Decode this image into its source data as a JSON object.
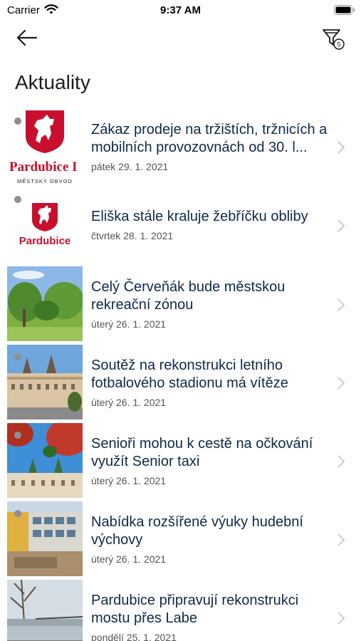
{
  "status_bar": {
    "carrier": "Carrier",
    "time": "9:37 AM"
  },
  "nav": {
    "back_icon": "arrow-left-icon",
    "filter_icon": "filter-icon",
    "filter_count": "5"
  },
  "page_title": "Aktuality",
  "logos": {
    "pardubice_i": "Pardubice I",
    "mestsky_obvod": "MĚSTSKÝ OBVOD",
    "pardubice": "Pardubice"
  },
  "articles": [
    {
      "title": "Zákaz prodeje na tržištích, tržnicích a mobilních provozovnách od 30. l...",
      "date": "pátek 29. 1. 2021",
      "unread": true
    },
    {
      "title": "Eliška stále kraluje žebříčku obliby",
      "date": "čtvrtek 28. 1. 2021",
      "unread": true
    },
    {
      "title": "Celý Červeňák bude městskou rekreační zónou",
      "date": "úterý 26. 1. 2021",
      "unread": false
    },
    {
      "title": "Soutěž na rekonstrukci letního fotbalového stadionu má vítěze",
      "date": "úterý 26. 1. 2021",
      "unread": true
    },
    {
      "title": "Senioři mohou k cestě na očkování využít Senior taxi",
      "date": "úterý 26. 1. 2021",
      "unread": true
    },
    {
      "title": "Nabídka rozšířené výuky hudební výchovy",
      "date": "úterý 26. 1. 2021",
      "unread": true
    },
    {
      "title": "Pardubice připravují rekonstrukci mostu přes Labe",
      "date": "pondělí 25. 1. 2021",
      "unread": false
    }
  ],
  "colors": {
    "brand_red": "#c8102e",
    "title_text": "#0d2a4a",
    "dot": "#8e8e93"
  }
}
